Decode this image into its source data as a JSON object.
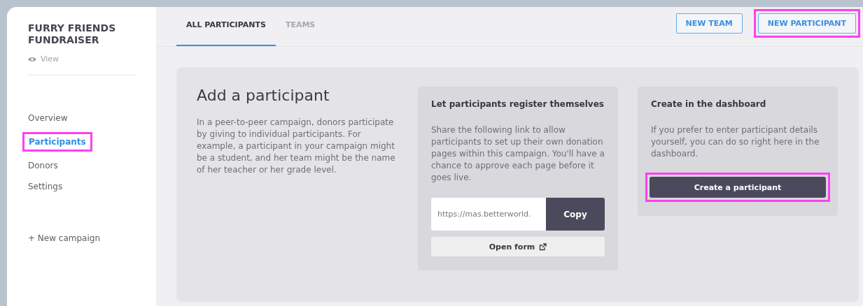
{
  "sidebar": {
    "title": "FURRY FRIENDS FUNDRAISER",
    "view_link": "View",
    "items": [
      {
        "label": "Overview",
        "selected": false,
        "highlighted": false
      },
      {
        "label": "Participants",
        "selected": true,
        "highlighted": true
      },
      {
        "label": "Donors",
        "selected": false,
        "highlighted": false
      },
      {
        "label": "Settings",
        "selected": false,
        "highlighted": false
      }
    ],
    "new_campaign": "+ New campaign"
  },
  "tabs": [
    {
      "label": "ALL PARTICIPANTS",
      "selected": true
    },
    {
      "label": "TEAMS",
      "selected": false
    }
  ],
  "header_buttons": [
    {
      "label": "NEW TEAM",
      "highlighted": false
    },
    {
      "label": "NEW PARTICIPANT",
      "highlighted": true
    }
  ],
  "intro": {
    "title": "Add a participant",
    "text": "In a peer-to-peer campaign, donors participate by giving to individual participants. For example, a participant in your campaign might be a student, and her team might be the name of her teacher or her grade level."
  },
  "register_card": {
    "title": "Let participants register themselves",
    "text": "Share the following link to allow participants to set up their own donation pages within this campaign. You'll have a chance to approve each page before it goes live.",
    "link_value": "https://mas.betterworld.",
    "copy_button": "Copy",
    "open_button": "Open form"
  },
  "dashboard_card": {
    "title": "Create in the dashboard",
    "text": "If you prefer to enter participant details yourself, you can do so right here in the dashboard.",
    "button": {
      "label": "Create a participant",
      "highlighted": true
    }
  }
}
